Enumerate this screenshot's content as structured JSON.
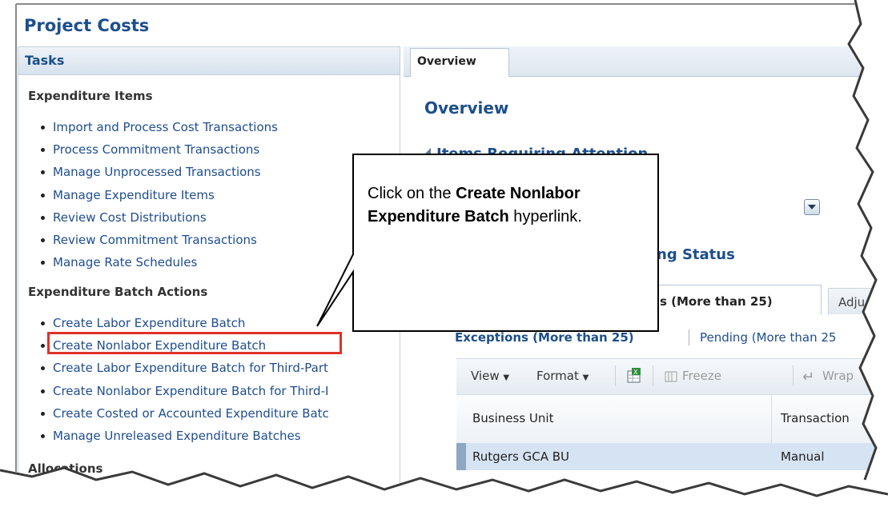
{
  "page": {
    "title": "Project Costs"
  },
  "tasks": {
    "title": "Tasks",
    "sections": [
      {
        "title": "Expenditure Items",
        "items": [
          "Import and Process Cost Transactions",
          "Process Commitment Transactions",
          "Manage Unprocessed Transactions",
          "Manage Expenditure Items",
          "Review Cost Distributions",
          "Review Commitment Transactions",
          "Manage Rate Schedules"
        ]
      },
      {
        "title": "Expenditure Batch Actions",
        "items": [
          "Create Labor Expenditure Batch",
          "Create Nonlabor Expenditure Batch",
          "Create Labor Expenditure Batch for Third-Part",
          "Create Nonlabor Expenditure Batch for Third-I",
          "Create Costed or Accounted Expenditure Batc",
          "Manage Unreleased Expenditure Batches"
        ]
      },
      {
        "title": "Allocations",
        "items": []
      }
    ]
  },
  "main": {
    "tab": "Overview",
    "heading": "Overview",
    "items_attention": "Items Requiring Attention",
    "status_heading": "ng Status",
    "subtab_active": "ons (More than 25)",
    "subtab_inactive": "Adju",
    "link_exceptions": "Exceptions (More than 25)",
    "link_pending": "Pending (More than 25",
    "toolbar": {
      "view": "View",
      "format": "Format",
      "freeze": "Freeze",
      "wrap": "Wrap"
    },
    "table": {
      "columns": [
        "Business Unit",
        "Transaction"
      ],
      "rows": [
        [
          "Rutgers GCA BU",
          "Manual"
        ]
      ]
    }
  },
  "callout": {
    "prefix": "Click on the ",
    "bold": "Create Nonlabor Expenditure Batch",
    "suffix": " hyperlink."
  }
}
